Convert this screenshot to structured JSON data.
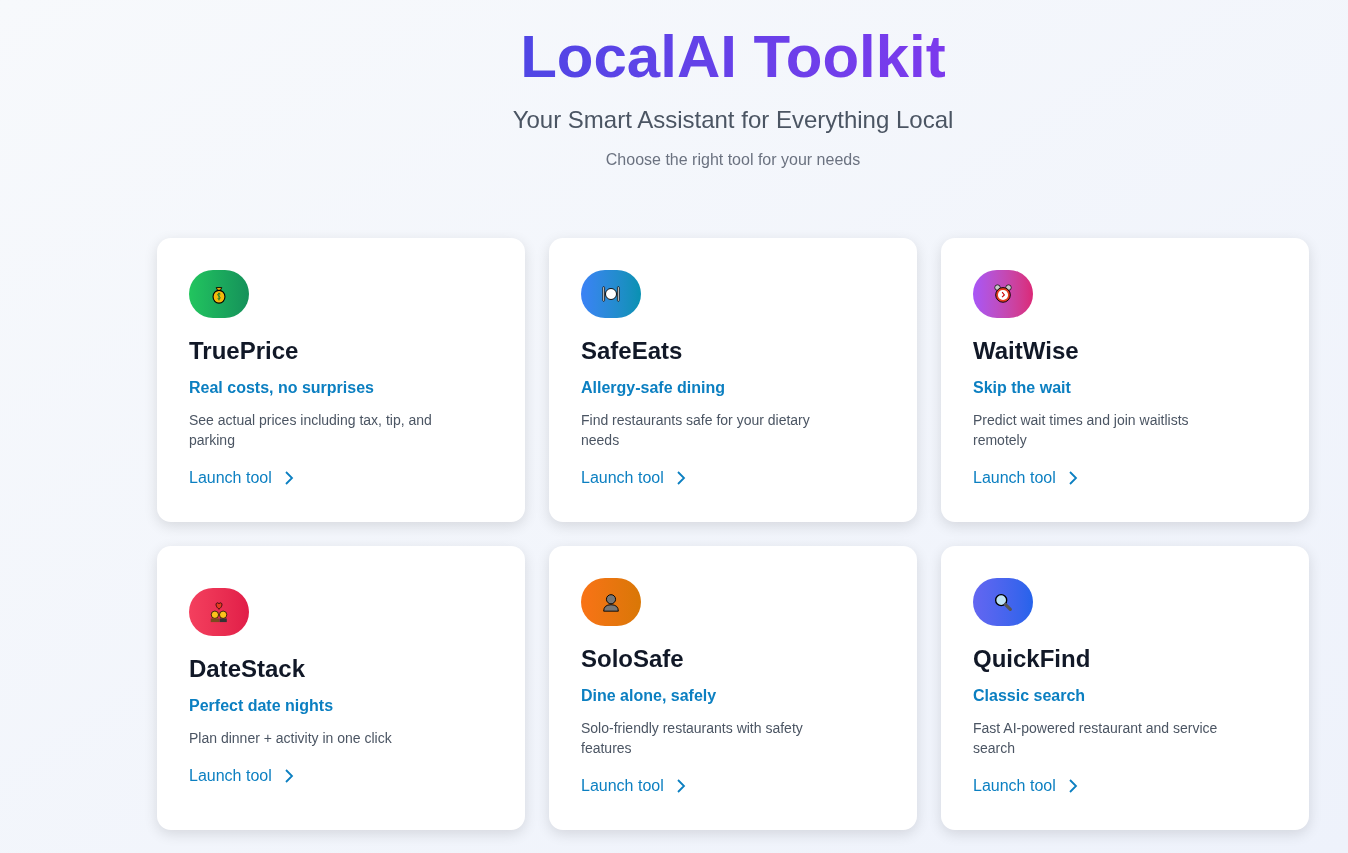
{
  "header": {
    "title": "LocalAI Toolkit",
    "subtitle": "Your Smart Assistant for Everything Local",
    "hint": "Choose the right tool for your needs"
  },
  "tools": [
    {
      "name": "TruePrice",
      "tagline": "Real costs, no surprises",
      "description": "See actual prices including tax, tip, and parking",
      "action": "Launch tool"
    },
    {
      "name": "SafeEats",
      "tagline": "Allergy-safe dining",
      "description": "Find restaurants safe for your dietary needs",
      "action": "Launch tool"
    },
    {
      "name": "WaitWise",
      "tagline": "Skip the wait",
      "description": "Predict wait times and join waitlists remotely",
      "action": "Launch tool"
    },
    {
      "name": "DateStack",
      "tagline": "Perfect date nights",
      "description": "Plan dinner + activity in one click",
      "action": "Launch tool"
    },
    {
      "name": "SoloSafe",
      "tagline": "Dine alone, safely",
      "description": "Solo-friendly restaurants with safety features",
      "action": "Launch tool"
    },
    {
      "name": "QuickFind",
      "tagline": "Classic search",
      "description": "Fast AI-powered restaurant and service search",
      "action": "Launch tool"
    }
  ]
}
